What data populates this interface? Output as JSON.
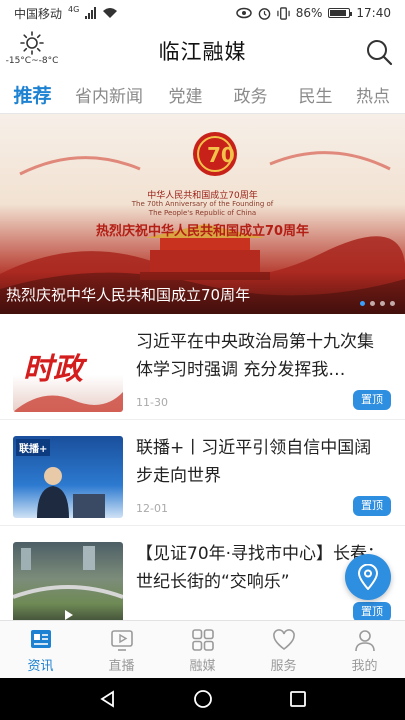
{
  "status_bar": {
    "carrier": "中国移动",
    "network": "4G",
    "battery": "86%",
    "time": "17:40"
  },
  "header": {
    "title": "临江融媒",
    "weather": "-15°C~-8°C",
    "weather_icon": "sun-icon",
    "search_icon": "search-icon"
  },
  "tabs": [
    {
      "label": "推荐",
      "active": true
    },
    {
      "label": "省内新闻",
      "active": false
    },
    {
      "label": "党建",
      "active": false
    },
    {
      "label": "政务",
      "active": false
    },
    {
      "label": "民生",
      "active": false
    },
    {
      "label": "热点",
      "active": false
    }
  ],
  "banner": {
    "caption": "热烈庆祝中华人民共和国成立70周年",
    "poster_line1": "中华人民共和国成立70周年",
    "poster_line2": "The 70th Anniversary of the Founding of",
    "poster_line3": "The People's Republic of China",
    "poster_slogan": "热烈庆祝中华人民共和国成立70周年",
    "emblem_number": "70",
    "dots_total": 4,
    "dots_active_index": 0
  },
  "news": [
    {
      "title": "习近平在中央政治局第十九次集体学习时强调 充分发挥我…",
      "date": "11-30",
      "badge": "置顶",
      "thumb_text": "时政"
    },
    {
      "title": "联播+丨习近平引领自信中国阔步走向世界",
      "date": "12-01",
      "badge": "置顶",
      "thumb_text": "联播+"
    },
    {
      "title": "【见证70年·寻找市中心】长春：世纪长街的“交响乐”",
      "date": "",
      "badge": "置顶",
      "thumb_text": ""
    }
  ],
  "bottom_tabs": [
    {
      "label": "资讯",
      "icon": "news-icon",
      "active": true
    },
    {
      "label": "直播",
      "icon": "live-icon",
      "active": false
    },
    {
      "label": "融媒",
      "icon": "grid-icon",
      "active": false
    },
    {
      "label": "服务",
      "icon": "heart-icon",
      "active": false
    },
    {
      "label": "我的",
      "icon": "user-icon",
      "active": false
    }
  ],
  "colors": {
    "accent": "#1e82d2",
    "badge": "#2e8ee0",
    "inactive": "#9a9a9a"
  }
}
